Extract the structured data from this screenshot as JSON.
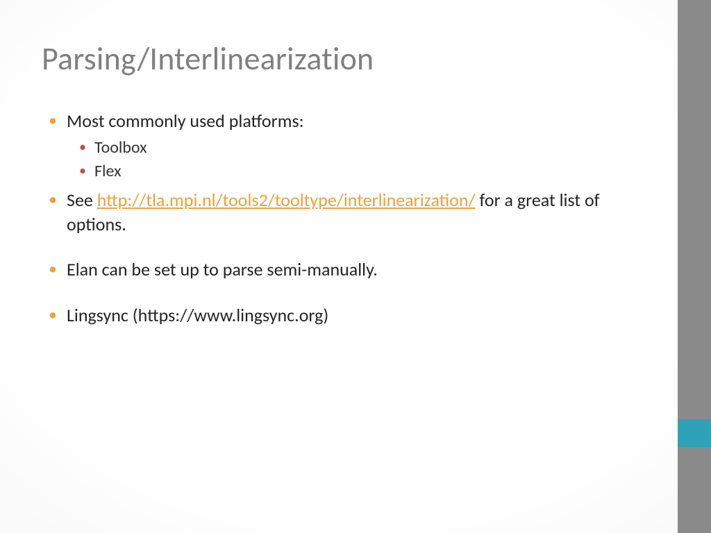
{
  "title": "Parsing/Interlinearization",
  "bullets": {
    "b1": "Most commonly used platforms:",
    "b1_sub": {
      "s1": "Toolbox",
      "s2": "Flex"
    },
    "b2_pre": "See ",
    "b2_link": "http://tla.mpi.nl/tools2/tooltype/interlinearization/",
    "b2_post": " for a great list of options.",
    "b3": "Elan can be set up to parse semi-manually.",
    "b4": "Lingsync (https://www.lingsync.org)"
  }
}
